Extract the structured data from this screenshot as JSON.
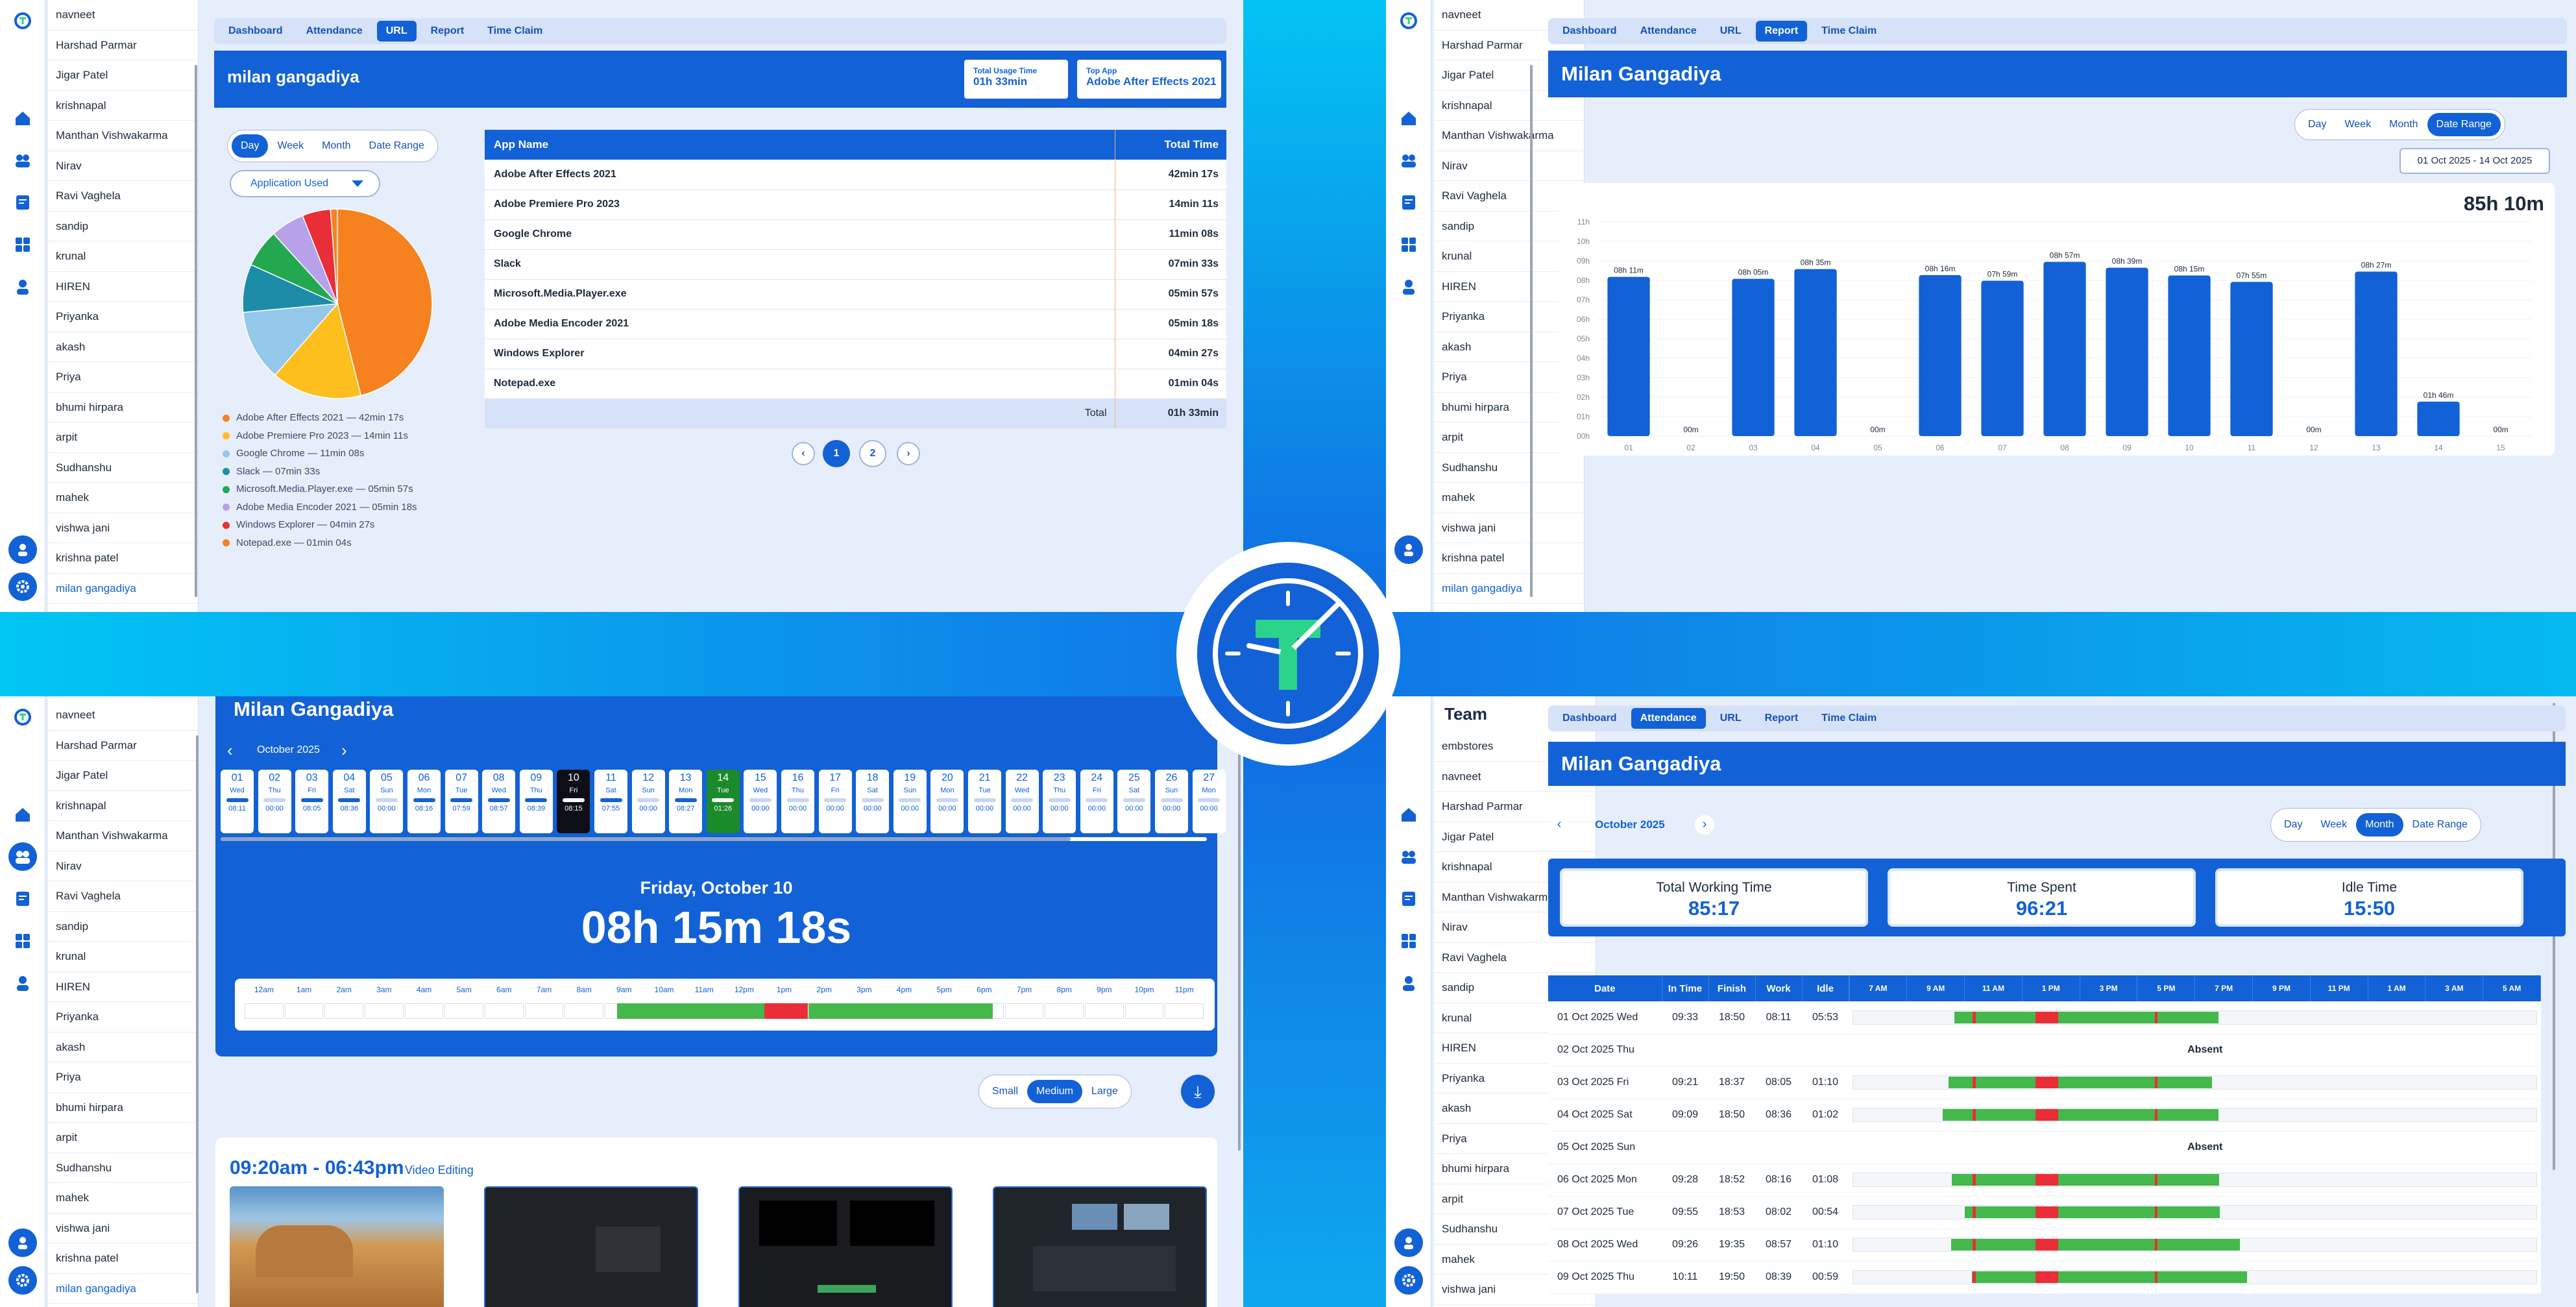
{
  "users_list": [
    "navneet",
    "Harshad Parmar",
    "Jigar Patel",
    "krishnapal",
    "Manthan Vishwakarma",
    "Nirav",
    "Ravi Vaghela",
    "sandip",
    "krunal",
    "HIREN",
    "Priyanka",
    "akash",
    "Priya",
    "bhumi hirpara",
    "arpit",
    "Sudhanshu",
    "mahek",
    "vishwa jani",
    "krishna patel",
    "milan gangadiya"
  ],
  "team_header": "Team",
  "team_users": [
    "embstores",
    "navneet",
    "Harshad Parmar",
    "Jigar Patel",
    "krishnapal",
    "Manthan Vishwakarma",
    "Nirav",
    "Ravi Vaghela",
    "sandip",
    "krunal",
    "HIREN",
    "Priyanka",
    "akash",
    "Priya",
    "bhumi hirpara",
    "arpit",
    "Sudhanshu",
    "mahek",
    "vishwa jani"
  ],
  "tabs": [
    "Dashboard",
    "Attendance",
    "URL",
    "Report",
    "Time Claim"
  ],
  "q1": {
    "name": "milan gangadiya",
    "total_usage_label": "Total Usage Time",
    "total_usage_value": "01h 33min",
    "top_app_label": "Top App",
    "top_app_value": "Adobe After Effects 2021",
    "periods": [
      "Day",
      "Week",
      "Month",
      "Date Range"
    ],
    "dropdown": "Application Used",
    "table_headers": [
      "App Name",
      "Total Time"
    ],
    "apps": [
      {
        "name": "Adobe After Effects 2021",
        "time": "42min 17s",
        "legend": "Adobe After Effects 2021 — 42min 17s",
        "color": "#f5821f",
        "minutes": 42.28
      },
      {
        "name": "Adobe Premiere Pro 2023",
        "time": "14min 11s",
        "legend": "Adobe Premiere Pro 2023 — 14min 11s",
        "color": "#fdbf1e",
        "minutes": 14.18
      },
      {
        "name": "Google Chrome",
        "time": "11min 08s",
        "legend": "Google Chrome — 11min 08s",
        "color": "#93c8ea",
        "minutes": 11.13
      },
      {
        "name": "Slack",
        "time": "07min 33s",
        "legend": "Slack — 07min 33s",
        "color": "#1d8ca8",
        "minutes": 7.55
      },
      {
        "name": "Microsoft.Media.Player.exe",
        "time": "05min 57s",
        "legend": "Microsoft.Media.Player.exe — 05min 57s",
        "color": "#23a84f",
        "minutes": 5.95
      },
      {
        "name": "Adobe Media Encoder 2021",
        "time": "05min 18s",
        "legend": "Adobe Media Encoder 2021 — 05min 18s",
        "color": "#b7a1ea",
        "minutes": 5.3
      },
      {
        "name": "Windows Explorer",
        "time": "04min 27s",
        "legend": "Windows Explorer — 04min 27s",
        "color": "#ea2e38",
        "minutes": 4.45
      },
      {
        "name": "Notepad.exe",
        "time": "01min 04s",
        "legend": "Notepad.exe — 01min 04s",
        "color": "#f5821f",
        "minutes": 1.07
      }
    ],
    "total_label": "Total",
    "total_value": "01h 33min",
    "pages": [
      "1",
      "2"
    ],
    "prev": "‹",
    "next": "›"
  },
  "q2": {
    "name": "Milan Gangadiya",
    "periods": [
      "Day",
      "Week",
      "Month",
      "Date Range"
    ],
    "date_range": "01 Oct 2025 - 14 Oct 2025",
    "total": "85h 10m"
  },
  "chart_data": {
    "type": "bar",
    "categories": [
      "01",
      "02",
      "03",
      "04",
      "05",
      "06",
      "07",
      "08",
      "09",
      "10",
      "11",
      "12",
      "13",
      "14",
      "15"
    ],
    "values": [
      8.18,
      0,
      8.08,
      8.58,
      0,
      8.27,
      7.98,
      8.95,
      8.65,
      8.25,
      7.92,
      0,
      8.45,
      1.77,
      0
    ],
    "data_labels": [
      "08h 11m",
      "00m",
      "08h 05m",
      "08h 35m",
      "00m",
      "08h 16m",
      "07h 59m",
      "08h 57m",
      "08h 39m",
      "08h 15m",
      "07h 55m",
      "00m",
      "08h 27m",
      "01h 46m",
      "00m"
    ],
    "yticks": [
      "11h",
      "10h",
      "09h",
      "08h",
      "07h",
      "06h",
      "05h",
      "04h",
      "03h",
      "02h",
      "01h",
      "00h"
    ],
    "ylim": [
      0,
      11
    ]
  },
  "q3": {
    "name": "Milan Gangadiya",
    "month": "October 2025",
    "days": [
      {
        "n": "01",
        "w": "Wed",
        "t": "08:11"
      },
      {
        "n": "02",
        "w": "Thu",
        "t": "00:00"
      },
      {
        "n": "03",
        "w": "Fri",
        "t": "08:05"
      },
      {
        "n": "04",
        "w": "Sat",
        "t": "08:36"
      },
      {
        "n": "05",
        "w": "Sun",
        "t": "00:00"
      },
      {
        "n": "06",
        "w": "Mon",
        "t": "08:16"
      },
      {
        "n": "07",
        "w": "Tue",
        "t": "07:59"
      },
      {
        "n": "08",
        "w": "Wed",
        "t": "08:57"
      },
      {
        "n": "09",
        "w": "Thu",
        "t": "08:39"
      },
      {
        "n": "10",
        "w": "Fri",
        "t": "08:15"
      },
      {
        "n": "11",
        "w": "Sat",
        "t": "07:55"
      },
      {
        "n": "12",
        "w": "Sun",
        "t": "00:00"
      },
      {
        "n": "13",
        "w": "Mon",
        "t": "08:27"
      },
      {
        "n": "14",
        "w": "Tue",
        "t": "01:26"
      },
      {
        "n": "15",
        "w": "Wed",
        "t": "00:00"
      },
      {
        "n": "16",
        "w": "Thu",
        "t": "00:00"
      },
      {
        "n": "17",
        "w": "Fri",
        "t": "00:00"
      },
      {
        "n": "18",
        "w": "Sat",
        "t": "00:00"
      },
      {
        "n": "19",
        "w": "Sun",
        "t": "00:00"
      },
      {
        "n": "20",
        "w": "Mon",
        "t": "00:00"
      },
      {
        "n": "21",
        "w": "Tue",
        "t": "00:00"
      },
      {
        "n": "22",
        "w": "Wed",
        "t": "00:00"
      },
      {
        "n": "23",
        "w": "Thu",
        "t": "00:00"
      },
      {
        "n": "24",
        "w": "Fri",
        "t": "00:00"
      },
      {
        "n": "25",
        "w": "Sat",
        "t": "00:00"
      },
      {
        "n": "26",
        "w": "Sun",
        "t": "00:00"
      },
      {
        "n": "27",
        "w": "Mon",
        "t": "00:00"
      }
    ],
    "selected_day": "10",
    "today": "14",
    "date_title": "Friday, October 10",
    "duration": "08h 15m 18s",
    "hours": [
      "12am",
      "1am",
      "2am",
      "3am",
      "4am",
      "5am",
      "6am",
      "7am",
      "8am",
      "9am",
      "10am",
      "11am",
      "12pm",
      "1pm",
      "2pm",
      "3pm",
      "4pm",
      "5pm",
      "6pm",
      "7pm",
      "8pm",
      "9pm",
      "10pm",
      "11pm"
    ],
    "sizes": [
      "Small",
      "Medium",
      "Large"
    ],
    "session_time": "09:20am - 06:43pm",
    "session_tag": "Video Editing"
  },
  "q4": {
    "name": "Milan Gangadiya",
    "month": "October 2025",
    "periods": [
      "Day",
      "Week",
      "Month",
      "Date Range"
    ],
    "summary": [
      {
        "label": "Total Working Time",
        "value": "85:17"
      },
      {
        "label": "Time Spent",
        "value": "96:21"
      },
      {
        "label": "Idle Time",
        "value": "15:50"
      }
    ],
    "headers": [
      "Date",
      "In Time",
      "Finish",
      "Work",
      "Idle"
    ],
    "hour_headers": [
      "7 AM",
      "9 AM",
      "11 AM",
      "1 PM",
      "3 PM",
      "5 PM",
      "7 PM",
      "9 PM",
      "11 PM",
      "1 AM",
      "3 AM",
      "5 AM"
    ],
    "absent_label": "Absent",
    "rows": [
      {
        "date": "01 Oct 2025 Wed",
        "in": "09:33",
        "out": "18:50",
        "work": "08:11",
        "idle": "05:53"
      },
      {
        "date": "02 Oct 2025 Thu",
        "absent": true
      },
      {
        "date": "03 Oct 2025 Fri",
        "in": "09:21",
        "out": "18:37",
        "work": "08:05",
        "idle": "01:10"
      },
      {
        "date": "04 Oct 2025 Sat",
        "in": "09:09",
        "out": "18:50",
        "work": "08:36",
        "idle": "01:02"
      },
      {
        "date": "05 Oct 2025 Sun",
        "absent": true
      },
      {
        "date": "06 Oct 2025 Mon",
        "in": "09:28",
        "out": "18:52",
        "work": "08:16",
        "idle": "01:08"
      },
      {
        "date": "07 Oct 2025 Tue",
        "in": "09:55",
        "out": "18:53",
        "work": "08:02",
        "idle": "00:54"
      },
      {
        "date": "08 Oct 2025 Wed",
        "in": "09:26",
        "out": "19:35",
        "work": "08:57",
        "idle": "01:10"
      },
      {
        "date": "09 Oct 2025 Thu",
        "in": "10:11",
        "out": "19:50",
        "work": "08:39",
        "idle": "00:59"
      }
    ]
  },
  "colors": {
    "primary": "#1261d6",
    "active_green": "#1a8a2a",
    "idle_red": "#ea2e38",
    "work_green": "#45b84b"
  }
}
